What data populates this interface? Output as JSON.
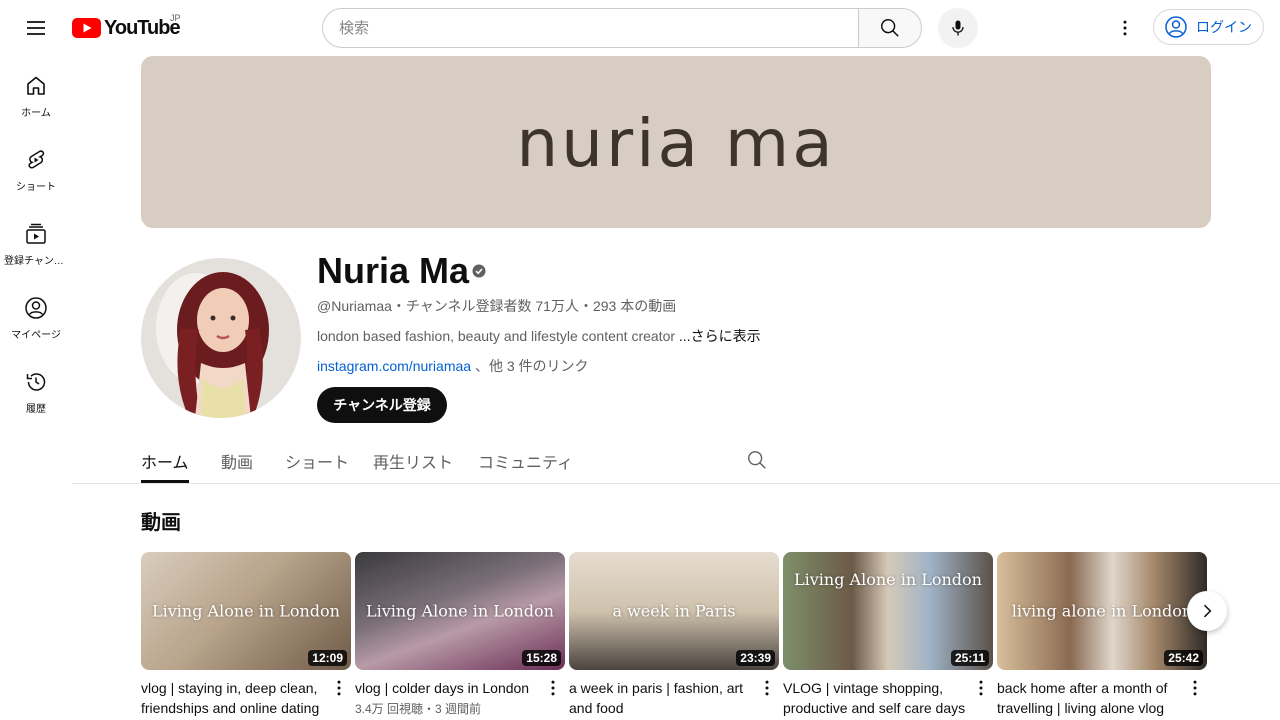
{
  "header": {
    "logo_text": "YouTube",
    "region": "JP",
    "search_placeholder": "検索",
    "login_label": "ログイン"
  },
  "sidebar": {
    "items": [
      {
        "label": "ホーム",
        "icon": "home-icon"
      },
      {
        "label": "ショート",
        "icon": "shorts-icon"
      },
      {
        "label": "登録チャンネル",
        "icon": "subscriptions-icon"
      },
      {
        "label": "マイページ",
        "icon": "you-icon"
      },
      {
        "label": "履歴",
        "icon": "history-icon"
      }
    ]
  },
  "banner": {
    "text": "nuria ma"
  },
  "channel": {
    "name": "Nuria Ma",
    "meta": "@Nuriamaa・チャンネル登録者数 71万人・293 本の動画",
    "description": "london based fashion, beauty and lifestyle content creator ",
    "description_more": "...さらに表示",
    "link": "instagram.com/nuriamaa",
    "link_suffix": " 、他 3 件のリンク",
    "subscribe_label": "チャンネル登録"
  },
  "tabs": [
    "ホーム",
    "動画",
    "ショート",
    "再生リスト",
    "コミュニティ"
  ],
  "section": {
    "title": "動画"
  },
  "videos": [
    {
      "title": "vlog | staying in, deep clean, friendships and online dating",
      "duration": "12:09",
      "overlay": "Living Alone in London",
      "meta": "",
      "colors": [
        "#c8b8a3",
        "#8a7461"
      ]
    },
    {
      "title": "vlog | colder days in London",
      "duration": "15:28",
      "overlay": "Living Alone in London",
      "meta": "3.4万 回視聴・3 週間前",
      "colors": [
        "#b8a9b2",
        "#6e3f5e"
      ]
    },
    {
      "title": "a week in paris | fashion, art and food",
      "duration": "23:39",
      "overlay": "a week in Paris",
      "meta": "",
      "colors": [
        "#d8cfc2",
        "#3d3a36"
      ]
    },
    {
      "title": "VLOG | vintage shopping, productive and self care days",
      "duration": "25:11",
      "overlay": "Living Alone in London",
      "meta": "",
      "colors": [
        "#8aa0b5",
        "#5a4a3a"
      ]
    },
    {
      "title": "back home after a month of travelling | living alone vlog",
      "duration": "25:42",
      "overlay": "living alone in London",
      "meta": "",
      "colors": [
        "#d9c2a5",
        "#3b3430"
      ]
    }
  ]
}
